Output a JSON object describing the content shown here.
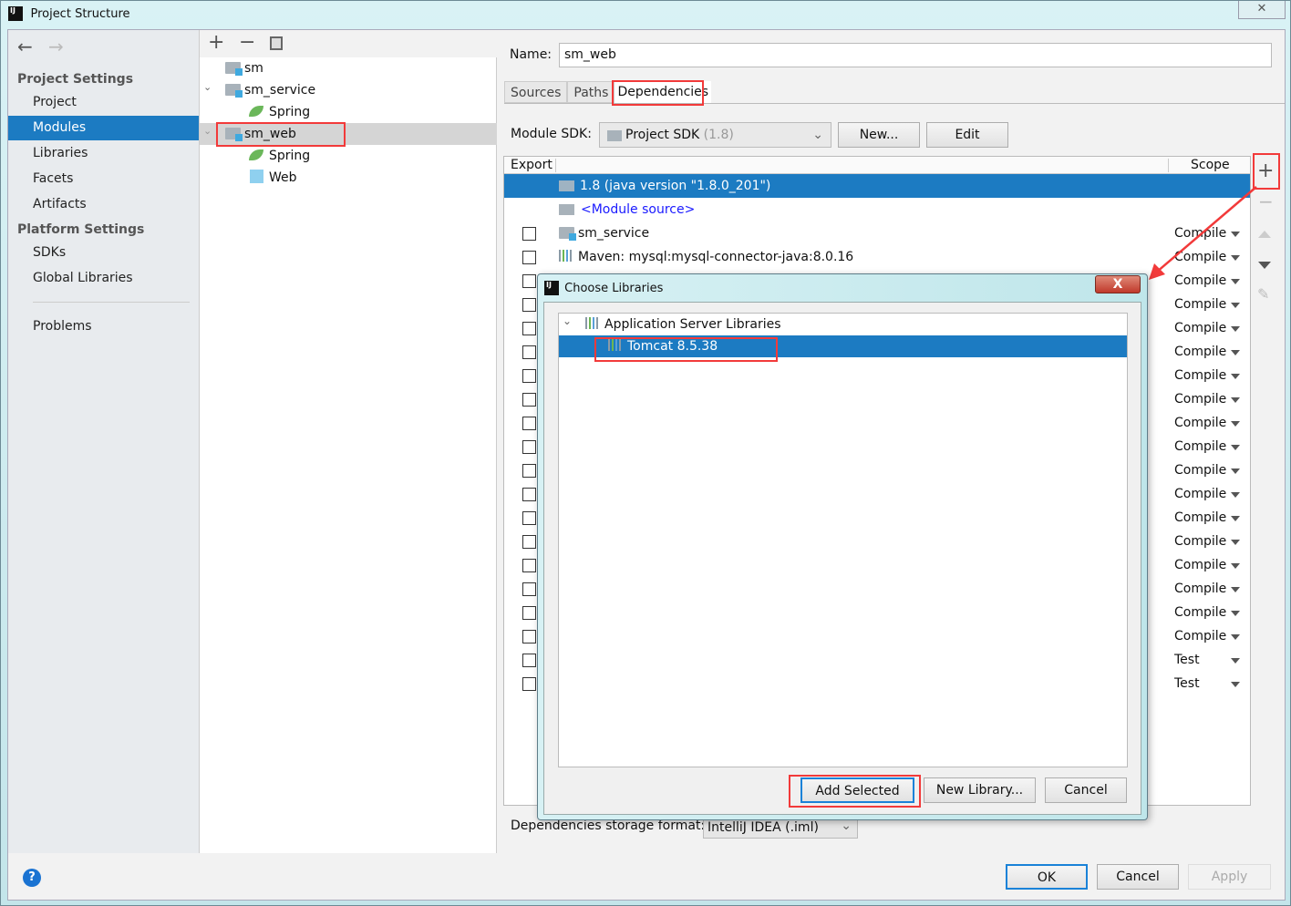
{
  "window": {
    "title": "Project Structure",
    "close": "✕"
  },
  "nav": {
    "back": "←",
    "forward": "→"
  },
  "sidebar": {
    "project_settings": "Project Settings",
    "platform_settings": "Platform Settings",
    "items": [
      {
        "label": "Project"
      },
      {
        "label": "Modules",
        "selected": true
      },
      {
        "label": "Libraries"
      },
      {
        "label": "Facets"
      },
      {
        "label": "Artifacts"
      }
    ],
    "platform_items": [
      {
        "label": "SDKs"
      },
      {
        "label": "Global Libraries"
      }
    ],
    "problems": "Problems"
  },
  "tree": {
    "toolbar": {
      "add": "+",
      "remove": "−"
    },
    "nodes": [
      {
        "label": "sm"
      },
      {
        "label": "sm_service"
      },
      {
        "label": "Spring"
      },
      {
        "label": "sm_web"
      },
      {
        "label": "Spring"
      },
      {
        "label": "Web"
      }
    ]
  },
  "module": {
    "name_label": "Name:",
    "name_value": "sm_web",
    "tabs": [
      {
        "label": "Sources"
      },
      {
        "label": "Paths"
      },
      {
        "label": "Dependencies",
        "active": true
      }
    ],
    "sdk_label": "Module SDK:",
    "sdk_value": "Project SDK",
    "sdk_version": "(1.8)",
    "new_button": "New...",
    "edit_button": "Edit",
    "table": {
      "export_header": "Export",
      "scope_header": "Scope",
      "jdk_row": "1.8 (java version \"1.8.0_201\")",
      "module_source": "<Module source>",
      "rows": [
        {
          "name": "sm_service",
          "scope": "Compile"
        },
        {
          "name": "Maven: mysql:mysql-connector-java:8.0.16",
          "scope": "Compile"
        }
      ],
      "scopes": [
        "Compile",
        "Compile",
        "Compile",
        "Compile",
        "Compile",
        "Compile",
        "Compile",
        "Compile",
        "Compile",
        "Compile",
        "Compile",
        "Compile",
        "Compile",
        "Compile",
        "Compile",
        "Compile",
        "Compile",
        "Compile",
        "Test",
        "Test"
      ]
    },
    "side_buttons": {
      "add": "+",
      "remove": "−"
    },
    "storage_label": "Dependencies storage format:",
    "storage_value": "IntelliJ IDEA (.iml)"
  },
  "dialog": {
    "title": "Choose Libraries",
    "close": "X",
    "group": "Application Server Libraries",
    "item": "Tomcat 8.5.38",
    "add_selected": "Add Selected",
    "new_library": "New Library...",
    "cancel": "Cancel"
  },
  "footer": {
    "help": "?",
    "ok": "OK",
    "cancel": "Cancel",
    "apply": "Apply"
  },
  "colors": {
    "selection": "#1c7bc2",
    "highlight": "#f23a3a",
    "link": "#1a1aff"
  }
}
